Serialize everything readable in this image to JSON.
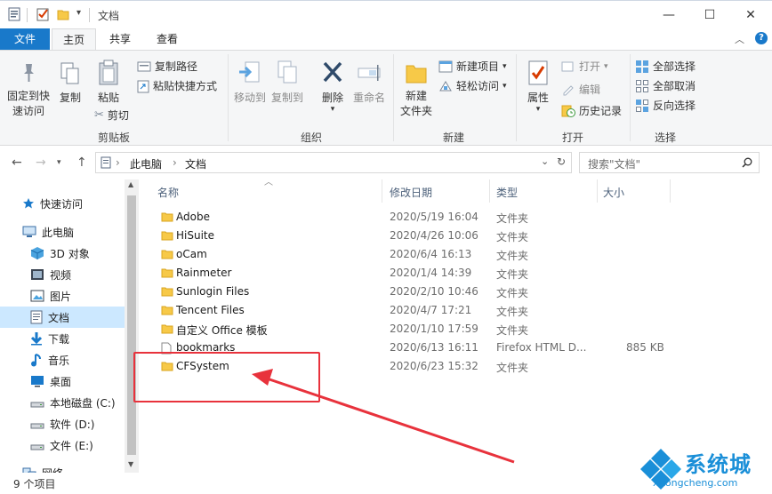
{
  "window": {
    "title": "文档",
    "controls": [
      "—",
      "☐",
      "✕"
    ]
  },
  "ribbon_tabs": {
    "file": "文件",
    "home": "主页",
    "share": "共享",
    "view": "查看"
  },
  "ribbon": {
    "clipboard": {
      "label": "剪贴板",
      "pin": "固定到快速访问",
      "pin_l1": "固定到快",
      "pin_l2": "速访问",
      "copy": "复制",
      "paste": "粘贴",
      "copy_path": "复制路径",
      "paste_shortcut": "粘贴快捷方式",
      "cut": "剪切"
    },
    "organize": {
      "label": "组织",
      "move_to": "移动到",
      "copy_to": "复制到",
      "delete": "删除",
      "rename": "重命名"
    },
    "new": {
      "label": "新建",
      "new_folder_l1": "新建",
      "new_folder_l2": "文件夹",
      "new_item": "新建项目",
      "easy_access": "轻松访问"
    },
    "open": {
      "label": "打开",
      "properties": "属性",
      "open": "打开",
      "edit": "编辑",
      "history": "历史记录"
    },
    "select": {
      "label": "选择",
      "select_all": "全部选择",
      "select_none": "全部取消",
      "invert": "反向选择"
    }
  },
  "address": {
    "breadcrumb": [
      "此电脑",
      "文档"
    ],
    "search_placeholder": "搜索\"文档\""
  },
  "nav_pane": [
    {
      "label": "快速访问",
      "icon": "star-icon",
      "indent": 0,
      "selected": false
    },
    {
      "label": "此电脑",
      "icon": "computer-icon",
      "indent": 0,
      "selected": false
    },
    {
      "label": "3D 对象",
      "icon": "3d-objects-icon",
      "indent": 1,
      "selected": false
    },
    {
      "label": "视频",
      "icon": "video-icon",
      "indent": 1,
      "selected": false
    },
    {
      "label": "图片",
      "icon": "pictures-icon",
      "indent": 1,
      "selected": false
    },
    {
      "label": "文档",
      "icon": "document-icon",
      "indent": 1,
      "selected": true
    },
    {
      "label": "下载",
      "icon": "download-icon",
      "indent": 1,
      "selected": false
    },
    {
      "label": "音乐",
      "icon": "music-icon",
      "indent": 1,
      "selected": false
    },
    {
      "label": "桌面",
      "icon": "desktop-icon",
      "indent": 1,
      "selected": false
    },
    {
      "label": "本地磁盘 (C:)",
      "icon": "drive-icon",
      "indent": 1,
      "selected": false
    },
    {
      "label": "软件 (D:)",
      "icon": "drive-icon",
      "indent": 1,
      "selected": false
    },
    {
      "label": "文件 (E:)",
      "icon": "drive-icon",
      "indent": 1,
      "selected": false
    },
    {
      "label": "网络",
      "icon": "network-icon",
      "indent": 0,
      "selected": false
    }
  ],
  "columns": {
    "name": "名称",
    "modified": "修改日期",
    "type": "类型",
    "size": "大小"
  },
  "files": [
    {
      "name": "Adobe",
      "modified": "2020/5/19 16:04",
      "type": "文件夹",
      "size": "",
      "kind": "folder"
    },
    {
      "name": "HiSuite",
      "modified": "2020/4/26 10:06",
      "type": "文件夹",
      "size": "",
      "kind": "folder"
    },
    {
      "name": "oCam",
      "modified": "2020/6/4 16:13",
      "type": "文件夹",
      "size": "",
      "kind": "folder"
    },
    {
      "name": "Rainmeter",
      "modified": "2020/1/4 14:39",
      "type": "文件夹",
      "size": "",
      "kind": "folder"
    },
    {
      "name": "Sunlogin Files",
      "modified": "2020/2/10 10:46",
      "type": "文件夹",
      "size": "",
      "kind": "folder"
    },
    {
      "name": "Tencent Files",
      "modified": "2020/4/7 17:21",
      "type": "文件夹",
      "size": "",
      "kind": "folder"
    },
    {
      "name": "自定义 Office 模板",
      "modified": "2020/1/10 17:59",
      "type": "文件夹",
      "size": "",
      "kind": "folder"
    },
    {
      "name": "bookmarks",
      "modified": "2020/6/13 16:11",
      "type": "Firefox HTML D...",
      "size": "885 KB",
      "kind": "file"
    },
    {
      "name": "CFSystem",
      "modified": "2020/6/23 15:32",
      "type": "文件夹",
      "size": "",
      "kind": "folder"
    }
  ],
  "status": {
    "count": "9 个项目"
  },
  "watermark": {
    "brand": "系统城",
    "url": "xitongcheng.com"
  },
  "colors": {
    "file_tab": "#1979ca",
    "folder": "#f7c948",
    "selection": "#cce8ff",
    "annotation": "#e8323c",
    "logo_blue": "#1a8fd8"
  }
}
